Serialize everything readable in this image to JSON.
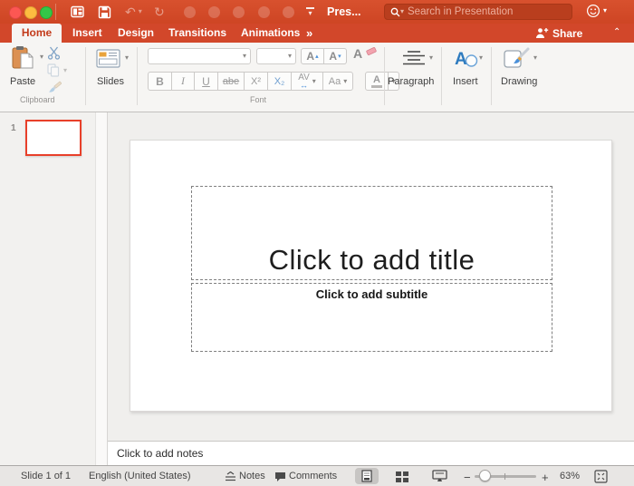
{
  "titlebar": {
    "title": "Pres...",
    "search_placeholder": "Search in Presentation",
    "undo_glyph": "↶",
    "redo_glyph": "↻",
    "dropdown_glyph": "▾"
  },
  "tabbar": {
    "tabs": [
      {
        "label": "Home",
        "active": true
      },
      {
        "label": "Insert"
      },
      {
        "label": "Design"
      },
      {
        "label": "Transitions"
      },
      {
        "label": "Animations"
      }
    ],
    "more_glyph": "»",
    "share_label": "Share",
    "collapse_glyph": "⌃"
  },
  "ribbon": {
    "paste_label": "Paste",
    "clipboard_label": "Clipboard",
    "slides_label": "Slides",
    "font_label": "Font",
    "paragraph_label": "Paragraph",
    "insert_label": "Insert",
    "drawing_label": "Drawing",
    "dropdown_glyph": "▾",
    "up_glyph": "▴",
    "font_buttons": {
      "bold": "B",
      "italic": "I",
      "underline": "U",
      "strikethrough": "abe",
      "superscript": "X²",
      "subscript": "X₂",
      "spacing": "AV",
      "spacing_arrow": "↔",
      "case": "Aa",
      "grow": "A",
      "shrink": "A",
      "color": "A",
      "clear": "A"
    }
  },
  "slide_panel": {
    "slide_number": "1"
  },
  "slide": {
    "title_placeholder": "Click to add title",
    "subtitle_placeholder": "Click to add subtitle"
  },
  "notes_placeholder": "Click to add notes",
  "statusbar": {
    "slide_count": "Slide 1 of 1",
    "language": "English (United States)",
    "notes_label": "Notes",
    "comments_label": "Comments",
    "zoom_minus": "−",
    "zoom_plus": "+",
    "zoom_level": "63%"
  },
  "colors": {
    "brand_red": "#D2472A",
    "selection_red": "#E8402A",
    "ribbon_bg": "#F6F5F3"
  }
}
